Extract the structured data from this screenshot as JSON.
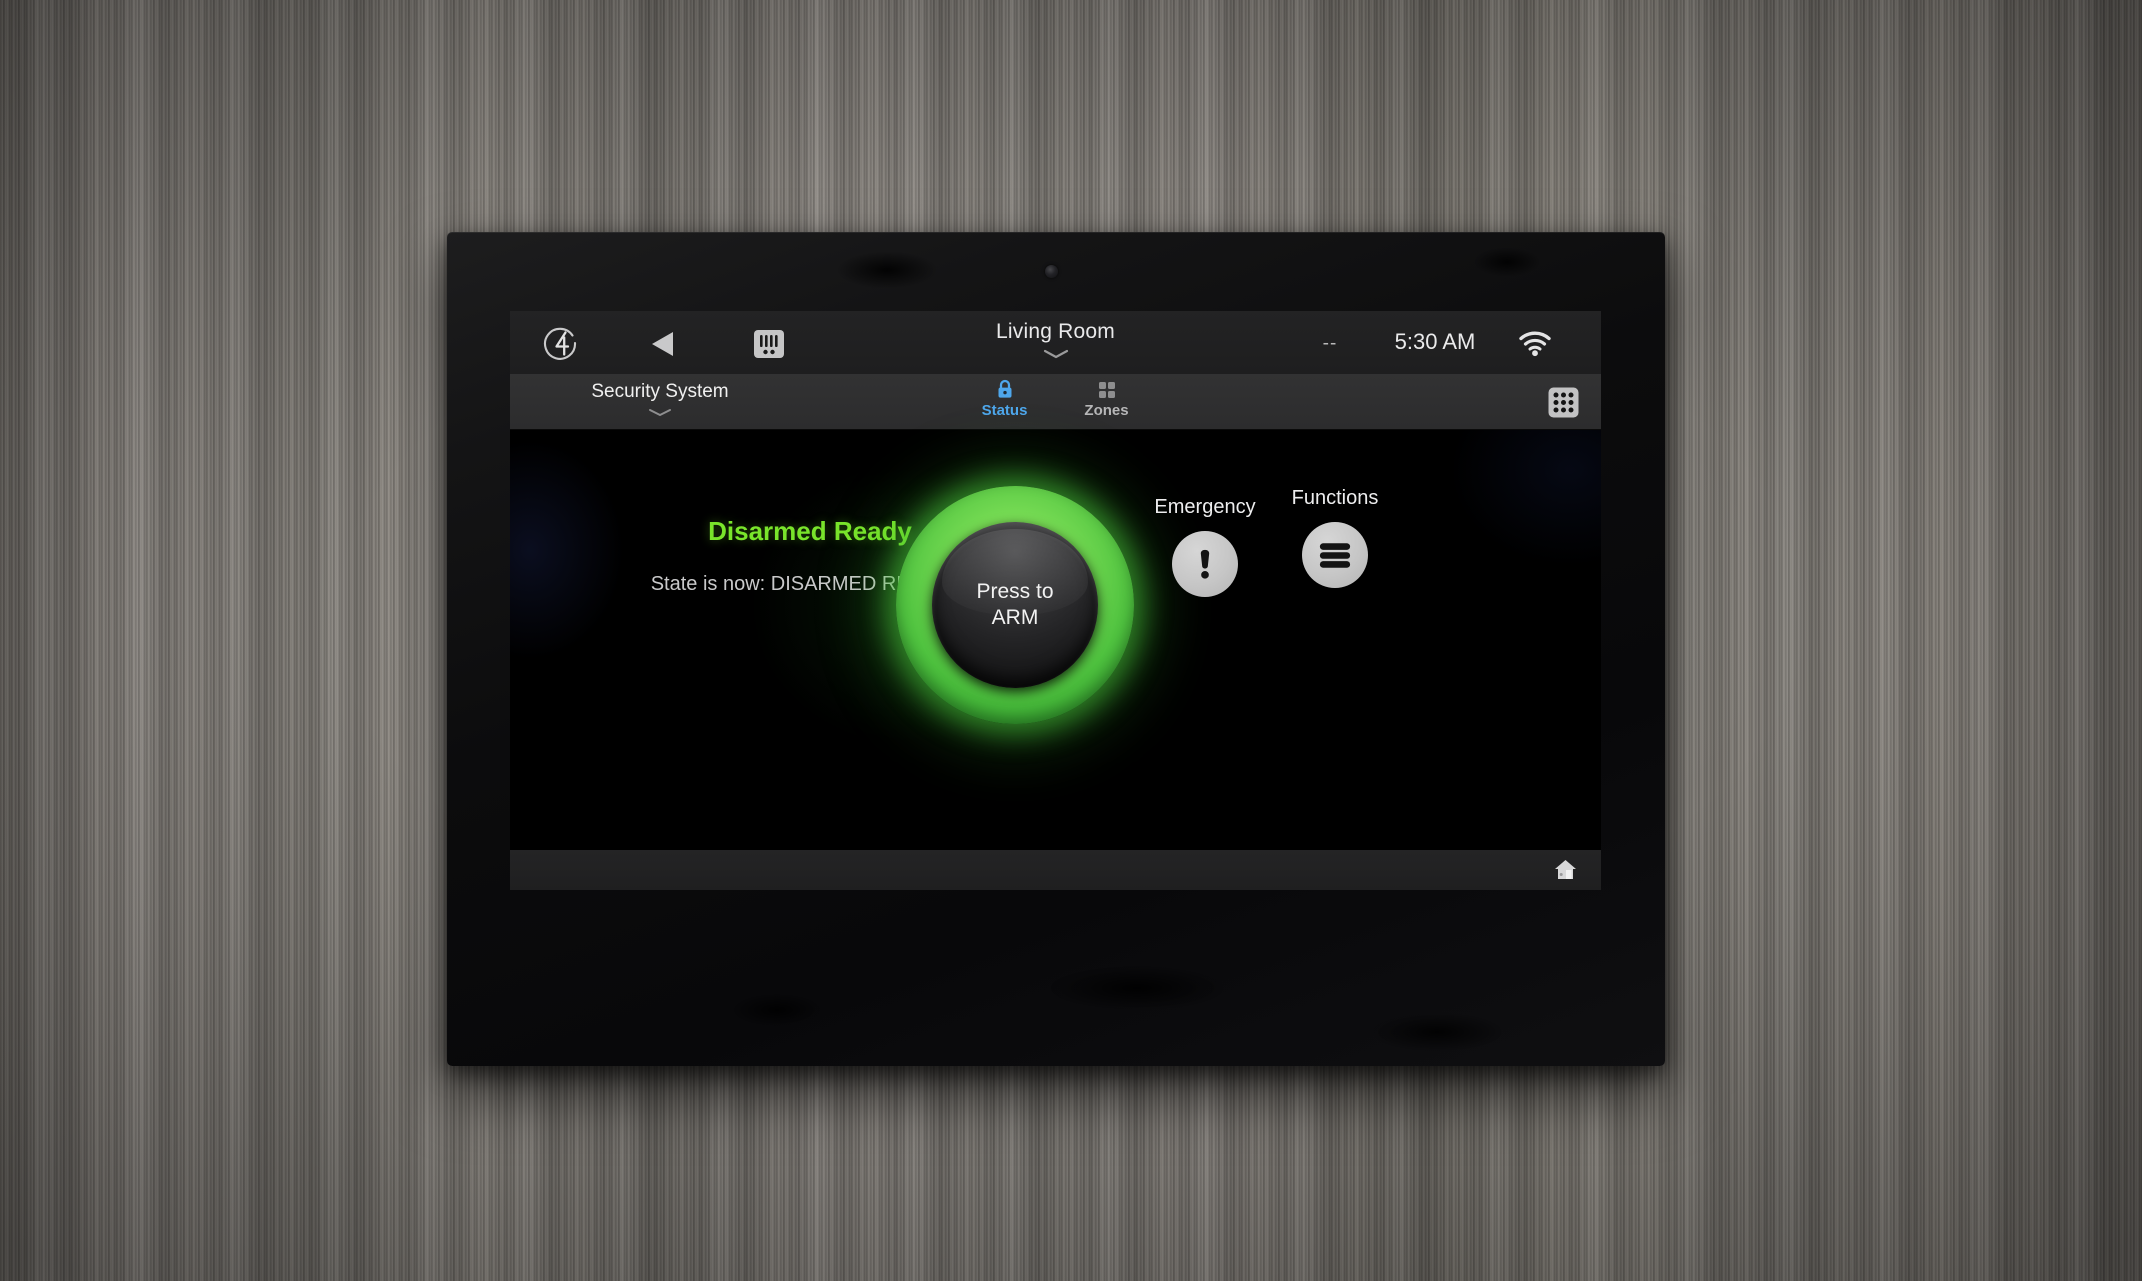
{
  "topbar": {
    "logo_icon": "control4-logo-icon",
    "back_icon": "back-arrow-icon",
    "intercom_icon": "intercom-icon",
    "room_name": "Living Room",
    "room_chevron_icon": "chevron-down-icon",
    "temperature": "--",
    "time": "5:30 AM",
    "wifi_icon": "wifi-icon"
  },
  "navbar": {
    "system_name": "Security System",
    "system_chevron_icon": "chevron-down-icon",
    "tabs": [
      {
        "label": "Status",
        "icon": "lock-icon",
        "active": true
      },
      {
        "label": "Zones",
        "icon": "grid-2x2-icon",
        "active": false
      }
    ],
    "keypad_icon": "keypad-3x3-icon"
  },
  "content": {
    "status_headline": "Disarmed Ready",
    "status_detail": "State is now: DISARMED READY ()",
    "arm_button_line1": "Press to",
    "arm_button_line2": "ARM",
    "actions": [
      {
        "label": "Emergency",
        "icon": "exclamation-icon"
      },
      {
        "label": "Functions",
        "icon": "hamburger-menu-icon"
      }
    ]
  },
  "bottombar": {
    "home_icon": "home-icon"
  },
  "colors": {
    "status_green": "#79e42b",
    "arm_ring_green": "#4fc23f",
    "tab_active_blue": "#4ea7ec",
    "screen_black": "#000000",
    "topbar_gray": "#1e1e1f",
    "navbar_gray": "#2e2e2f",
    "action_circle_gray": "#c6c6c6"
  }
}
